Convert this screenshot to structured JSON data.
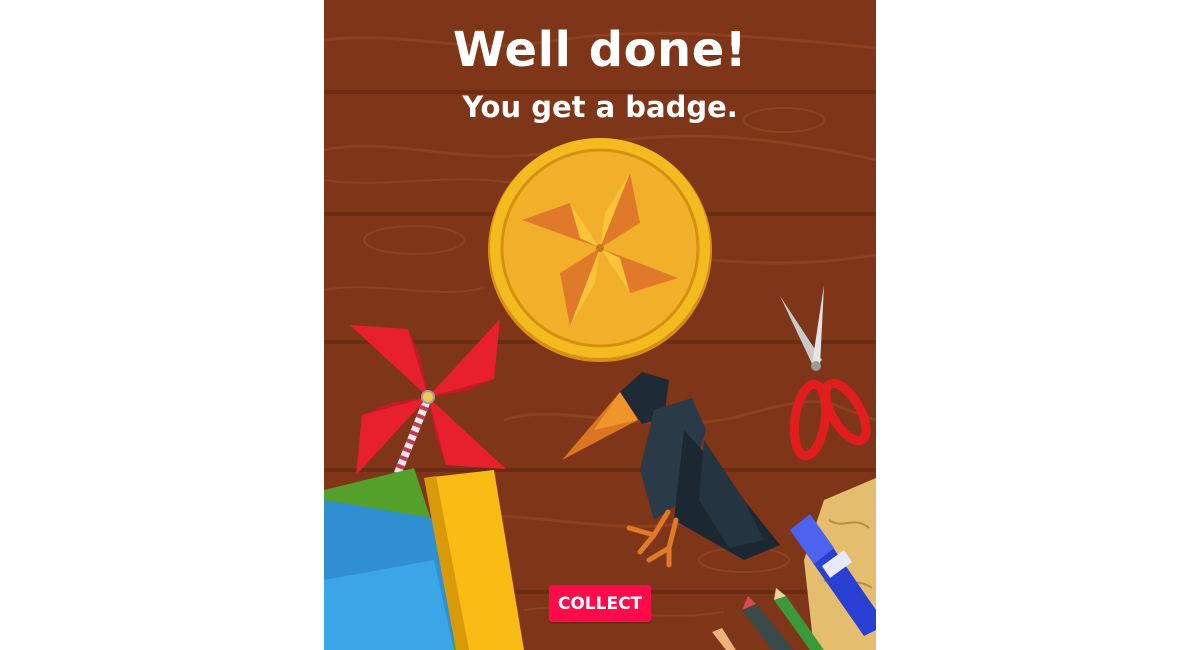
{
  "celebration": {
    "heading": "Well done!",
    "subheading": "You get a badge."
  },
  "badge": {
    "icon": "pinwheel-icon",
    "colors": {
      "rim": "#f3bb1f",
      "face": "#f2b02a",
      "pinwheel_dark": "#e07a2a",
      "pinwheel_light": "#f9c33a"
    }
  },
  "actions": {
    "collect_label": "COLLECT"
  },
  "colors": {
    "background_wood": "#7e3518",
    "button": "#ff0a4a"
  }
}
